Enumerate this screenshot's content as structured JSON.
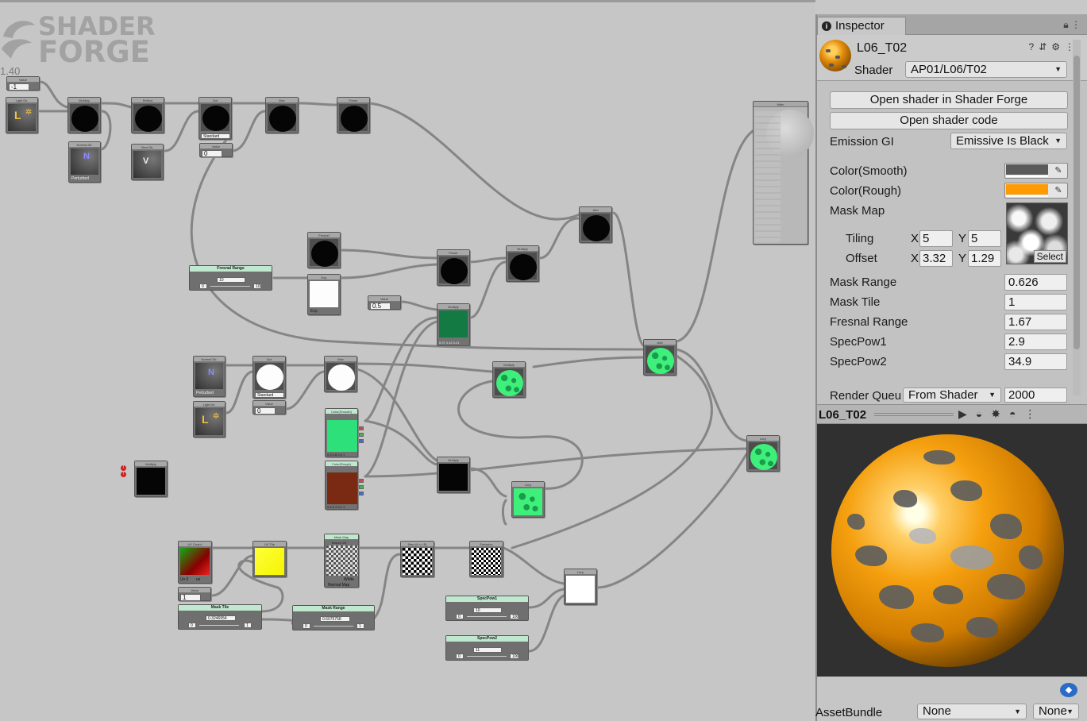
{
  "brand": {
    "line1": "SHADER",
    "line2": "FORGE",
    "version": "1.40"
  },
  "graph": {
    "value_neg": "-1",
    "value_zero": "0",
    "value_half": "0.5",
    "value_zero_b": "0",
    "value_one": "1",
    "dot_mode": "Standard",
    "dot_mode_b": "Standard",
    "normal_perturbed": "Perturbed",
    "normal_perturbed_b": "Perturbed",
    "light_dir_glyph": "L",
    "normal_dir_glyph": "N",
    "view_dir_glyph": "V",
    "exp_mode": "Exp",
    "uv_channel": "Uv 0",
    "uv_mode": "uv",
    "mask_sampler": "White",
    "normal_map": "Normal Map",
    "sliders": {
      "fresnel": {
        "title": "Fresnal Range",
        "min": "0",
        "max": "10",
        "value": "10"
      },
      "mask_tile": {
        "title": "Mask Tile",
        "min": "0",
        "max": "1",
        "value": "0.3246954"
      },
      "mask_range": {
        "title": "Mask Range",
        "min": "0",
        "max": "1",
        "value": "0.6075758"
      },
      "specpow1": {
        "title": "SpecPow1",
        "min": "0",
        "max": "100",
        "value": "10"
      },
      "specpow2": {
        "title": "SpecPow2",
        "min": "0",
        "max": "100",
        "value": "11"
      }
    },
    "node_titles": {
      "multiply": "Multiply",
      "reflect": "Reflect",
      "dot": "Dot",
      "max": "Max",
      "power": "Power",
      "light_dir": "Light Dir.",
      "normal_dir": "Normal Dir.",
      "view_dir": "View Dir.",
      "value": "Value",
      "fresnel": "Fresnel",
      "exp": "Exp",
      "add": "Add",
      "lerp": "Lerp",
      "color_smooth": "Color(Smooth)",
      "color_rough": "Color(Rough)",
      "color": "Color",
      "main": "Main",
      "uv_coord": "UV Coord.",
      "uv_tile": "UV Tile",
      "mask_map": "Mask Map",
      "texture2d": "Texture 2D",
      "step": "Step (A <= B)",
      "emission": "Emission"
    },
    "color_smooth_vals": "0.5 0.8 0.4 1",
    "color_rough_vals": "0.4 0.1 0.1 1",
    "green_vals": "0.07 0.42 0.21"
  },
  "inspector": {
    "tab": "Inspector",
    "material_name": "L06_T02",
    "shader_label": "Shader",
    "shader_value": "AP01/L06/T02",
    "open_forge": "Open shader in Shader Forge",
    "open_code": "Open shader code",
    "emission_gi_label": "Emission GI",
    "emission_gi_value": "Emissive Is Black",
    "color_smooth_label": "Color(Smooth)",
    "color_rough_label": "Color(Rough)",
    "mask_map_label": "Mask Map",
    "tiling_label": "Tiling",
    "offset_label": "Offset",
    "x_label": "X",
    "y_label": "Y",
    "tiling_x": "5",
    "tiling_y": "5",
    "offset_x": "3.32",
    "offset_y": "1.29",
    "select": "Select",
    "mask_range_label": "Mask Range",
    "mask_range": "0.626",
    "mask_tile_label": "Mask Tile",
    "mask_tile": "1",
    "fresnal_range_label": "Fresnal Range",
    "fresnal_range": "1.67",
    "specpow1_label": "SpecPow1",
    "specpow1": "2.9",
    "specpow2_label": "SpecPow2",
    "specpow2": "34.9",
    "render_queue_label": "Render Queu",
    "render_queue_mode": "From Shader",
    "render_queue_value": "2000",
    "preview_title": "L06_T02",
    "assetbundle_label": "AssetBundle",
    "assetbundle_value": "None",
    "assetbundle_variant": "None"
  },
  "colors": {
    "color_smooth": "#5a5a5a",
    "color_rough": "#ff9a00",
    "node_green": "#127a42",
    "node_bright_green": "#2ee07a",
    "node_brown": "#7a2a12"
  }
}
